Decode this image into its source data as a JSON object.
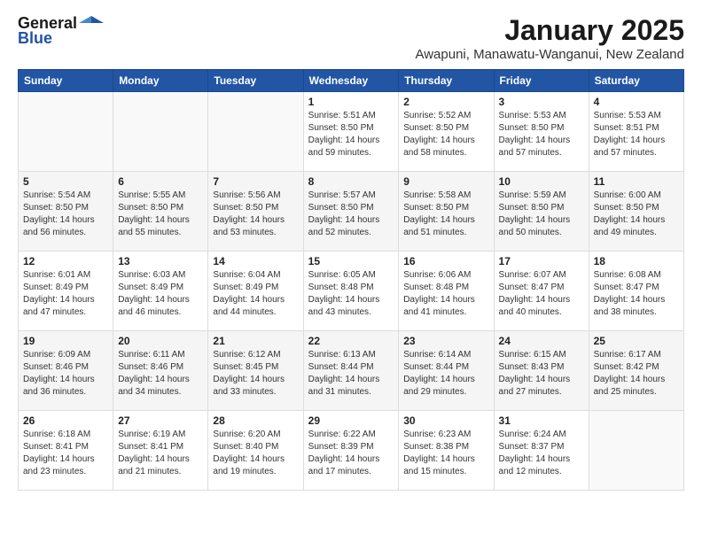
{
  "header": {
    "logo_general": "General",
    "logo_blue": "Blue",
    "month": "January 2025",
    "location": "Awapuni, Manawatu-Wanganui, New Zealand"
  },
  "weekdays": [
    "Sunday",
    "Monday",
    "Tuesday",
    "Wednesday",
    "Thursday",
    "Friday",
    "Saturday"
  ],
  "weeks": [
    [
      {
        "day": "",
        "info": ""
      },
      {
        "day": "",
        "info": ""
      },
      {
        "day": "",
        "info": ""
      },
      {
        "day": "1",
        "info": "Sunrise: 5:51 AM\nSunset: 8:50 PM\nDaylight: 14 hours\nand 59 minutes."
      },
      {
        "day": "2",
        "info": "Sunrise: 5:52 AM\nSunset: 8:50 PM\nDaylight: 14 hours\nand 58 minutes."
      },
      {
        "day": "3",
        "info": "Sunrise: 5:53 AM\nSunset: 8:50 PM\nDaylight: 14 hours\nand 57 minutes."
      },
      {
        "day": "4",
        "info": "Sunrise: 5:53 AM\nSunset: 8:51 PM\nDaylight: 14 hours\nand 57 minutes."
      }
    ],
    [
      {
        "day": "5",
        "info": "Sunrise: 5:54 AM\nSunset: 8:50 PM\nDaylight: 14 hours\nand 56 minutes."
      },
      {
        "day": "6",
        "info": "Sunrise: 5:55 AM\nSunset: 8:50 PM\nDaylight: 14 hours\nand 55 minutes."
      },
      {
        "day": "7",
        "info": "Sunrise: 5:56 AM\nSunset: 8:50 PM\nDaylight: 14 hours\nand 53 minutes."
      },
      {
        "day": "8",
        "info": "Sunrise: 5:57 AM\nSunset: 8:50 PM\nDaylight: 14 hours\nand 52 minutes."
      },
      {
        "day": "9",
        "info": "Sunrise: 5:58 AM\nSunset: 8:50 PM\nDaylight: 14 hours\nand 51 minutes."
      },
      {
        "day": "10",
        "info": "Sunrise: 5:59 AM\nSunset: 8:50 PM\nDaylight: 14 hours\nand 50 minutes."
      },
      {
        "day": "11",
        "info": "Sunrise: 6:00 AM\nSunset: 8:50 PM\nDaylight: 14 hours\nand 49 minutes."
      }
    ],
    [
      {
        "day": "12",
        "info": "Sunrise: 6:01 AM\nSunset: 8:49 PM\nDaylight: 14 hours\nand 47 minutes."
      },
      {
        "day": "13",
        "info": "Sunrise: 6:03 AM\nSunset: 8:49 PM\nDaylight: 14 hours\nand 46 minutes."
      },
      {
        "day": "14",
        "info": "Sunrise: 6:04 AM\nSunset: 8:49 PM\nDaylight: 14 hours\nand 44 minutes."
      },
      {
        "day": "15",
        "info": "Sunrise: 6:05 AM\nSunset: 8:48 PM\nDaylight: 14 hours\nand 43 minutes."
      },
      {
        "day": "16",
        "info": "Sunrise: 6:06 AM\nSunset: 8:48 PM\nDaylight: 14 hours\nand 41 minutes."
      },
      {
        "day": "17",
        "info": "Sunrise: 6:07 AM\nSunset: 8:47 PM\nDaylight: 14 hours\nand 40 minutes."
      },
      {
        "day": "18",
        "info": "Sunrise: 6:08 AM\nSunset: 8:47 PM\nDaylight: 14 hours\nand 38 minutes."
      }
    ],
    [
      {
        "day": "19",
        "info": "Sunrise: 6:09 AM\nSunset: 8:46 PM\nDaylight: 14 hours\nand 36 minutes."
      },
      {
        "day": "20",
        "info": "Sunrise: 6:11 AM\nSunset: 8:46 PM\nDaylight: 14 hours\nand 34 minutes."
      },
      {
        "day": "21",
        "info": "Sunrise: 6:12 AM\nSunset: 8:45 PM\nDaylight: 14 hours\nand 33 minutes."
      },
      {
        "day": "22",
        "info": "Sunrise: 6:13 AM\nSunset: 8:44 PM\nDaylight: 14 hours\nand 31 minutes."
      },
      {
        "day": "23",
        "info": "Sunrise: 6:14 AM\nSunset: 8:44 PM\nDaylight: 14 hours\nand 29 minutes."
      },
      {
        "day": "24",
        "info": "Sunrise: 6:15 AM\nSunset: 8:43 PM\nDaylight: 14 hours\nand 27 minutes."
      },
      {
        "day": "25",
        "info": "Sunrise: 6:17 AM\nSunset: 8:42 PM\nDaylight: 14 hours\nand 25 minutes."
      }
    ],
    [
      {
        "day": "26",
        "info": "Sunrise: 6:18 AM\nSunset: 8:41 PM\nDaylight: 14 hours\nand 23 minutes."
      },
      {
        "day": "27",
        "info": "Sunrise: 6:19 AM\nSunset: 8:41 PM\nDaylight: 14 hours\nand 21 minutes."
      },
      {
        "day": "28",
        "info": "Sunrise: 6:20 AM\nSunset: 8:40 PM\nDaylight: 14 hours\nand 19 minutes."
      },
      {
        "day": "29",
        "info": "Sunrise: 6:22 AM\nSunset: 8:39 PM\nDaylight: 14 hours\nand 17 minutes."
      },
      {
        "day": "30",
        "info": "Sunrise: 6:23 AM\nSunset: 8:38 PM\nDaylight: 14 hours\nand 15 minutes."
      },
      {
        "day": "31",
        "info": "Sunrise: 6:24 AM\nSunset: 8:37 PM\nDaylight: 14 hours\nand 12 minutes."
      },
      {
        "day": "",
        "info": ""
      }
    ]
  ]
}
